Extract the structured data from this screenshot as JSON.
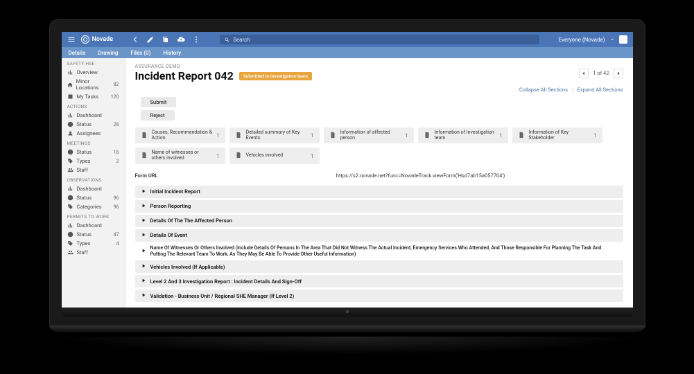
{
  "brand": "Novade",
  "search": {
    "placeholder": "Search"
  },
  "user": {
    "label": "Everyone (Novade)"
  },
  "subtabs": [
    "Details",
    "Drawing",
    "Files (0)",
    "History"
  ],
  "sidebar": [
    {
      "title": "SAFETY-HSE",
      "items": [
        {
          "icon": "chart",
          "label": "Overview",
          "count": ""
        },
        {
          "icon": "building",
          "label": "Minor Locations",
          "count": "82"
        },
        {
          "icon": "task",
          "label": "My Tasks",
          "count": "120"
        }
      ]
    },
    {
      "title": "ACTIONS",
      "items": [
        {
          "icon": "chart",
          "label": "Dashboard",
          "count": ""
        },
        {
          "icon": "clock",
          "label": "Status",
          "count": "28"
        },
        {
          "icon": "user",
          "label": "Assignees",
          "count": ""
        }
      ]
    },
    {
      "title": "MEETINGS",
      "items": [
        {
          "icon": "clock",
          "label": "Status",
          "count": "16"
        },
        {
          "icon": "tag",
          "label": "Types",
          "count": "2"
        },
        {
          "icon": "people",
          "label": "Staff",
          "count": ""
        }
      ]
    },
    {
      "title": "OBSERVATIONS",
      "items": [
        {
          "icon": "chart",
          "label": "Dashboard",
          "count": ""
        },
        {
          "icon": "clock",
          "label": "Status",
          "count": "96"
        },
        {
          "icon": "tag",
          "label": "Categories",
          "count": "96"
        }
      ]
    },
    {
      "title": "PERMITS TO WORK",
      "items": [
        {
          "icon": "chart",
          "label": "Dashboard",
          "count": ""
        },
        {
          "icon": "clock",
          "label": "Status",
          "count": "47"
        },
        {
          "icon": "tag",
          "label": "Types",
          "count": "4"
        },
        {
          "icon": "people",
          "label": "Staff",
          "count": ""
        }
      ]
    }
  ],
  "crumb": "ASSURANCE DEMO",
  "title": "Incident Report 042",
  "status": "Submitted to Investigation team",
  "pager": {
    "text": "1 of 42"
  },
  "links": {
    "collapse": "Collapse All Sections",
    "expand": "Expand All Sections"
  },
  "actions": [
    "Submit",
    "Reject"
  ],
  "cards": [
    {
      "label": "Causes, Recommendation & Action",
      "count": "1"
    },
    {
      "label": "Detailed summary of Key Events",
      "count": "1"
    },
    {
      "label": "Information of affected person",
      "count": "1"
    },
    {
      "label": "Information of Investigation team",
      "count": "1"
    },
    {
      "label": "Information of Key Stakeholder",
      "count": "1"
    },
    {
      "label": "Name of witnesses or others involved",
      "count": "1"
    },
    {
      "label": "Vehicles involved",
      "count": "1"
    }
  ],
  "form_url": {
    "label": "Form URL",
    "value": "https://s2.novade.net?func=NovadeTrack.viewForm('Hsd7ab15a057704')"
  },
  "sections": [
    {
      "label": "Initial Incident Report"
    },
    {
      "label": "Person Reporting"
    },
    {
      "label": "Details Of The The Affected Person"
    },
    {
      "label": "Details Of Event"
    },
    {
      "label": "Name Of Witnesses Or Others Involved (Include Details Of Persons In The Area That Did Not Witness The Actual Incident, Emergency Services Who Attended, And Those Responsible For Planning The Task And Putting The Relevant Team To Work, As They May Be Able To Provide Other Useful Information)",
      "plain": true
    },
    {
      "label": "Vehicles Involved (If Applicable)"
    },
    {
      "label": "Level 2 And 3 Investigation Report : Incident Details And Sign-Off"
    },
    {
      "label": "Validation - Business Unit / Regional SHE Manager (If Level 2)"
    }
  ]
}
